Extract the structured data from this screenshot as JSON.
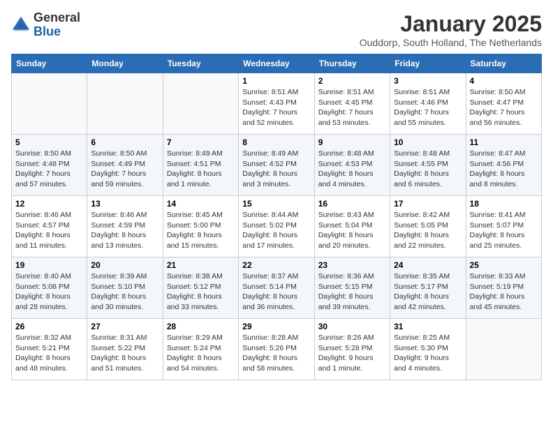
{
  "header": {
    "logo_general": "General",
    "logo_blue": "Blue",
    "month_title": "January 2025",
    "location": "Ouddorp, South Holland, The Netherlands"
  },
  "weekdays": [
    "Sunday",
    "Monday",
    "Tuesday",
    "Wednesday",
    "Thursday",
    "Friday",
    "Saturday"
  ],
  "weeks": [
    [
      {
        "day": "",
        "info": ""
      },
      {
        "day": "",
        "info": ""
      },
      {
        "day": "",
        "info": ""
      },
      {
        "day": "1",
        "info": "Sunrise: 8:51 AM\nSunset: 4:43 PM\nDaylight: 7 hours and 52 minutes."
      },
      {
        "day": "2",
        "info": "Sunrise: 8:51 AM\nSunset: 4:45 PM\nDaylight: 7 hours and 53 minutes."
      },
      {
        "day": "3",
        "info": "Sunrise: 8:51 AM\nSunset: 4:46 PM\nDaylight: 7 hours and 55 minutes."
      },
      {
        "day": "4",
        "info": "Sunrise: 8:50 AM\nSunset: 4:47 PM\nDaylight: 7 hours and 56 minutes."
      }
    ],
    [
      {
        "day": "5",
        "info": "Sunrise: 8:50 AM\nSunset: 4:48 PM\nDaylight: 7 hours and 57 minutes."
      },
      {
        "day": "6",
        "info": "Sunrise: 8:50 AM\nSunset: 4:49 PM\nDaylight: 7 hours and 59 minutes."
      },
      {
        "day": "7",
        "info": "Sunrise: 8:49 AM\nSunset: 4:51 PM\nDaylight: 8 hours and 1 minute."
      },
      {
        "day": "8",
        "info": "Sunrise: 8:49 AM\nSunset: 4:52 PM\nDaylight: 8 hours and 3 minutes."
      },
      {
        "day": "9",
        "info": "Sunrise: 8:48 AM\nSunset: 4:53 PM\nDaylight: 8 hours and 4 minutes."
      },
      {
        "day": "10",
        "info": "Sunrise: 8:48 AM\nSunset: 4:55 PM\nDaylight: 8 hours and 6 minutes."
      },
      {
        "day": "11",
        "info": "Sunrise: 8:47 AM\nSunset: 4:56 PM\nDaylight: 8 hours and 8 minutes."
      }
    ],
    [
      {
        "day": "12",
        "info": "Sunrise: 8:46 AM\nSunset: 4:57 PM\nDaylight: 8 hours and 11 minutes."
      },
      {
        "day": "13",
        "info": "Sunrise: 8:46 AM\nSunset: 4:59 PM\nDaylight: 8 hours and 13 minutes."
      },
      {
        "day": "14",
        "info": "Sunrise: 8:45 AM\nSunset: 5:00 PM\nDaylight: 8 hours and 15 minutes."
      },
      {
        "day": "15",
        "info": "Sunrise: 8:44 AM\nSunset: 5:02 PM\nDaylight: 8 hours and 17 minutes."
      },
      {
        "day": "16",
        "info": "Sunrise: 8:43 AM\nSunset: 5:04 PM\nDaylight: 8 hours and 20 minutes."
      },
      {
        "day": "17",
        "info": "Sunrise: 8:42 AM\nSunset: 5:05 PM\nDaylight: 8 hours and 22 minutes."
      },
      {
        "day": "18",
        "info": "Sunrise: 8:41 AM\nSunset: 5:07 PM\nDaylight: 8 hours and 25 minutes."
      }
    ],
    [
      {
        "day": "19",
        "info": "Sunrise: 8:40 AM\nSunset: 5:08 PM\nDaylight: 8 hours and 28 minutes."
      },
      {
        "day": "20",
        "info": "Sunrise: 8:39 AM\nSunset: 5:10 PM\nDaylight: 8 hours and 30 minutes."
      },
      {
        "day": "21",
        "info": "Sunrise: 8:38 AM\nSunset: 5:12 PM\nDaylight: 8 hours and 33 minutes."
      },
      {
        "day": "22",
        "info": "Sunrise: 8:37 AM\nSunset: 5:14 PM\nDaylight: 8 hours and 36 minutes."
      },
      {
        "day": "23",
        "info": "Sunrise: 8:36 AM\nSunset: 5:15 PM\nDaylight: 8 hours and 39 minutes."
      },
      {
        "day": "24",
        "info": "Sunrise: 8:35 AM\nSunset: 5:17 PM\nDaylight: 8 hours and 42 minutes."
      },
      {
        "day": "25",
        "info": "Sunrise: 8:33 AM\nSunset: 5:19 PM\nDaylight: 8 hours and 45 minutes."
      }
    ],
    [
      {
        "day": "26",
        "info": "Sunrise: 8:32 AM\nSunset: 5:21 PM\nDaylight: 8 hours and 48 minutes."
      },
      {
        "day": "27",
        "info": "Sunrise: 8:31 AM\nSunset: 5:22 PM\nDaylight: 8 hours and 51 minutes."
      },
      {
        "day": "28",
        "info": "Sunrise: 8:29 AM\nSunset: 5:24 PM\nDaylight: 8 hours and 54 minutes."
      },
      {
        "day": "29",
        "info": "Sunrise: 8:28 AM\nSunset: 5:26 PM\nDaylight: 8 hours and 58 minutes."
      },
      {
        "day": "30",
        "info": "Sunrise: 8:26 AM\nSunset: 5:28 PM\nDaylight: 9 hours and 1 minute."
      },
      {
        "day": "31",
        "info": "Sunrise: 8:25 AM\nSunset: 5:30 PM\nDaylight: 9 hours and 4 minutes."
      },
      {
        "day": "",
        "info": ""
      }
    ]
  ]
}
